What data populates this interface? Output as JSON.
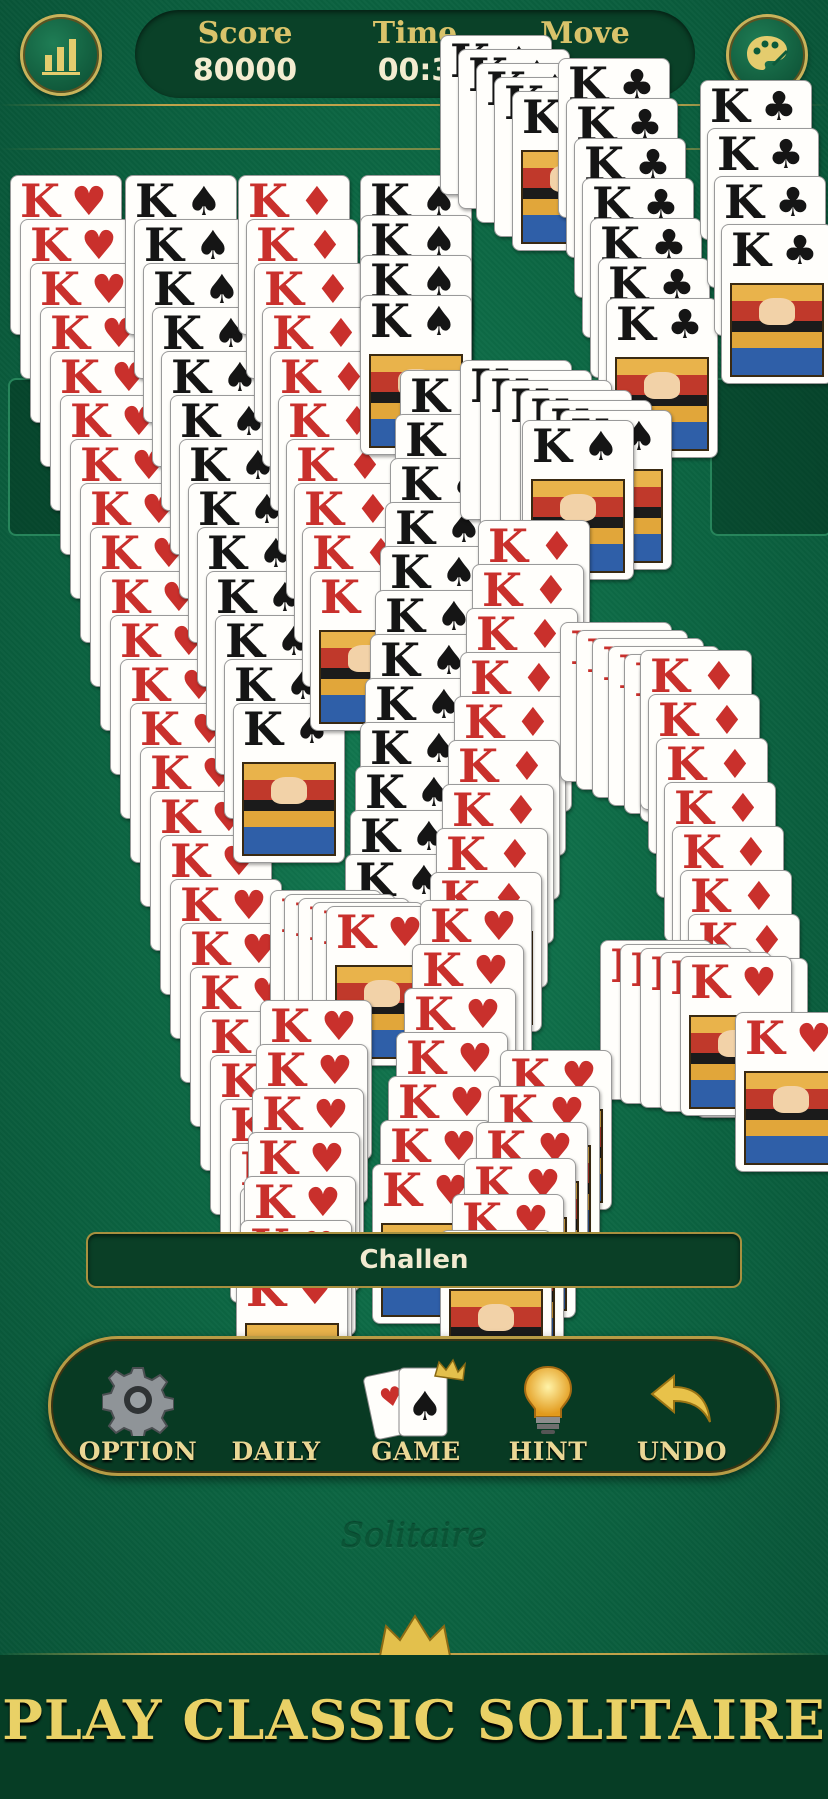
{
  "header": {
    "score_label": "Score",
    "score_value": "80000",
    "time_label": "Time",
    "time_value": "00:3",
    "moves_label": "Move"
  },
  "challenge_bar": {
    "text": "Challen"
  },
  "toolbar": {
    "option_label": "OPTION",
    "daily_label": "DAILY",
    "game_label": "GAME",
    "hint_label": "HINT",
    "undo_label": "UNDO"
  },
  "brand": {
    "text": "Solitaire"
  },
  "banner": {
    "text": "PLAY CLASSIC SOLITAIRE"
  },
  "cards": {
    "rank": "K",
    "hearts": "♥",
    "spades": "♠",
    "diamonds": "♦",
    "clubs": "♣"
  },
  "colors": {
    "felt": "#0c6743",
    "gold": "#c9b25a",
    "card_red": "#c9302c",
    "banner_text": "#e9d166"
  },
  "icons": [
    "stats-icon",
    "palette-icon",
    "gear-icon",
    "cards-icon",
    "crown-icon",
    "bulb-icon",
    "undo-arrow-icon"
  ]
}
